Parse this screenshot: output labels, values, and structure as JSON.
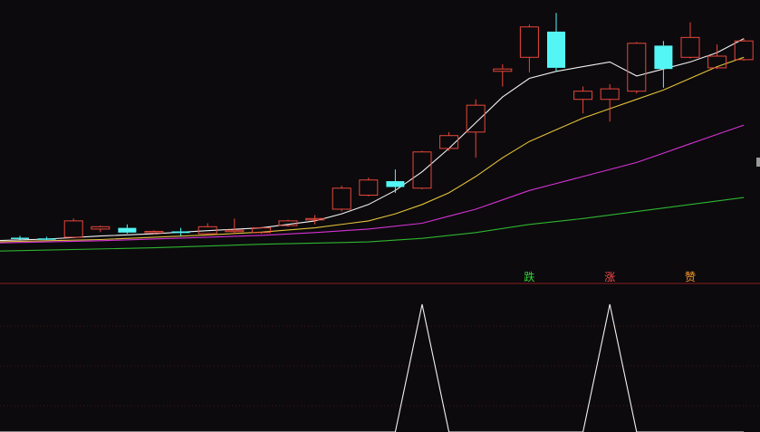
{
  "colors": {
    "background": "#0c0a0d",
    "up": "#e8463a",
    "down": "#54f5f5",
    "ma5": "#f2f2f2",
    "ma10": "#e3c23a",
    "ma20": "#d632d6",
    "ma60": "#2fb52f",
    "grid": "#4a1616",
    "separator": "#8a2020",
    "indicator": "#f2f2f2",
    "signal_green": "#2fd42f",
    "signal_red": "#ff4a4a",
    "signal_orange": "#ff9a2a"
  },
  "signals": [
    {
      "text": "跌",
      "candle_index": 20,
      "color": "#2fd42f"
    },
    {
      "text": "涨",
      "candle_index": 23,
      "color": "#ff4a4a"
    },
    {
      "text": "赞",
      "candle_index": 26,
      "color": "#ff9a2a"
    }
  ],
  "chart_data": [
    {
      "type": "candlestick",
      "ylim": [
        0,
        100
      ],
      "x": [
        1,
        2,
        3,
        4,
        5,
        6,
        7,
        8,
        9,
        10,
        11,
        12,
        13,
        14,
        15,
        16,
        17,
        18,
        19,
        20,
        21,
        22,
        23,
        24,
        25,
        26,
        27,
        28
      ],
      "candles": [
        {
          "o": 6.8,
          "h": 7.6,
          "l": 6.0,
          "c": 6.4
        },
        {
          "o": 6.5,
          "h": 7.2,
          "l": 5.8,
          "c": 6.3
        },
        {
          "o": 7.0,
          "h": 15.0,
          "l": 6.6,
          "c": 14.0
        },
        {
          "o": 10.5,
          "h": 12.0,
          "l": 9.2,
          "c": 11.5
        },
        {
          "o": 11.0,
          "h": 12.5,
          "l": 8.5,
          "c": 9.0
        },
        {
          "o": 9.0,
          "h": 10.0,
          "l": 8.2,
          "c": 9.5
        },
        {
          "o": 9.5,
          "h": 11.0,
          "l": 7.5,
          "c": 8.8
        },
        {
          "o": 8.5,
          "h": 13.0,
          "l": 8.0,
          "c": 11.5
        },
        {
          "o": 9.5,
          "h": 15.0,
          "l": 8.5,
          "c": 10.0
        },
        {
          "o": 9.0,
          "h": 11.5,
          "l": 8.5,
          "c": 11.0
        },
        {
          "o": 12.0,
          "h": 14.5,
          "l": 11.5,
          "c": 14.0
        },
        {
          "o": 15.0,
          "h": 16.5,
          "l": 12.5,
          "c": 15.0
        },
        {
          "o": 19.0,
          "h": 29.0,
          "l": 18.0,
          "c": 28.0
        },
        {
          "o": 25.0,
          "h": 32.5,
          "l": 24.5,
          "c": 31.5
        },
        {
          "o": 31.0,
          "h": 36.0,
          "l": 26.0,
          "c": 28.5
        },
        {
          "o": 28.0,
          "h": 44.0,
          "l": 27.5,
          "c": 43.5
        },
        {
          "o": 45.0,
          "h": 52.0,
          "l": 44.0,
          "c": 50.5
        },
        {
          "o": 52.0,
          "h": 66.0,
          "l": 41.0,
          "c": 63.5
        },
        {
          "o": 78.0,
          "h": 81.0,
          "l": 71.5,
          "c": 79.0
        },
        {
          "o": 84.0,
          "h": 98.0,
          "l": 77.5,
          "c": 97.0
        },
        {
          "o": 95.0,
          "h": 103.0,
          "l": 78.0,
          "c": 79.5
        },
        {
          "o": 66.0,
          "h": 71.5,
          "l": 60.0,
          "c": 69.5
        },
        {
          "o": 66.0,
          "h": 72.5,
          "l": 56.5,
          "c": 70.5
        },
        {
          "o": 69.5,
          "h": 90.5,
          "l": 68.5,
          "c": 90.0
        },
        {
          "o": 89.0,
          "h": 91.0,
          "l": 71.0,
          "c": 79.0
        },
        {
          "o": 84.0,
          "h": 99.0,
          "l": 83.5,
          "c": 92.5
        },
        {
          "o": 79.5,
          "h": 89.5,
          "l": 79.0,
          "c": 84.5
        },
        {
          "o": 83.0,
          "h": 92.0,
          "l": 82.5,
          "c": 91.0
        }
      ],
      "series": [
        {
          "x": [
            0,
            2,
            4,
            6,
            8,
            10,
            12,
            13,
            14,
            15,
            16,
            17,
            18,
            19,
            20,
            21,
            22,
            23,
            24,
            25,
            26,
            27,
            28
          ],
          "values": [
            5.5,
            6.2,
            7.5,
            8.5,
            9.8,
            11,
            14,
            17,
            21,
            27,
            35,
            45,
            56,
            67,
            75,
            78,
            80,
            82,
            76,
            79,
            82,
            86,
            92
          ]
        },
        {
          "x": [
            0,
            4,
            8,
            10,
            12,
            14,
            15,
            16,
            17,
            18,
            19,
            20,
            21,
            22,
            23,
            24,
            25,
            26,
            27,
            28
          ],
          "values": [
            5,
            6,
            8,
            9.2,
            11,
            14,
            17,
            21,
            26,
            33,
            41,
            48,
            53,
            58,
            62,
            66,
            70,
            75,
            80,
            84
          ]
        },
        {
          "x": [
            0,
            4,
            8,
            10,
            12,
            14,
            16,
            17,
            18,
            19,
            20,
            21,
            22,
            23,
            24,
            25,
            26,
            27,
            28
          ],
          "values": [
            4.5,
            5.5,
            7,
            7.8,
            9,
            10.5,
            13,
            16,
            19,
            23,
            27,
            30,
            33,
            36,
            39,
            43,
            47,
            51,
            55
          ]
        },
        {
          "x": [
            0,
            6,
            10,
            14,
            16,
            18,
            20,
            22,
            24,
            26,
            28
          ],
          "values": [
            1,
            2.5,
            4,
            5,
            6.5,
            9,
            12.5,
            15,
            18,
            21,
            24
          ]
        }
      ]
    },
    {
      "type": "line",
      "ylim": [
        0,
        1
      ],
      "x": [
        0,
        14,
        15,
        16,
        17,
        21,
        22,
        23,
        24,
        28
      ],
      "values": [
        0,
        0,
        0,
        1,
        0,
        0,
        0,
        1,
        0,
        0
      ]
    }
  ]
}
